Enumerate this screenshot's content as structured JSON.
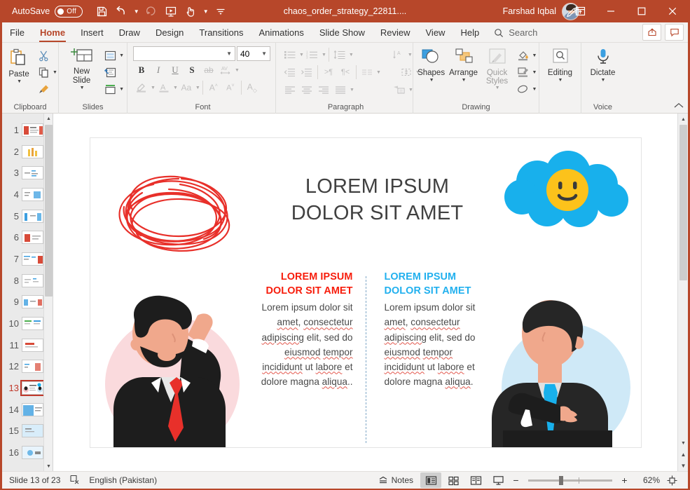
{
  "titlebar": {
    "autosave_label": "AutoSave",
    "autosave_state": "Off",
    "document_title": "chaos_order_strategy_22811....",
    "user_name": "Farshad Iqbal",
    "quick_access": [
      {
        "name": "save-icon",
        "label": "Save"
      },
      {
        "name": "undo-icon",
        "label": "Undo"
      },
      {
        "name": "redo-icon",
        "label": "Redo"
      },
      {
        "name": "start-presentation-icon",
        "label": "Start From Beginning"
      },
      {
        "name": "touch-mode-icon",
        "label": "Touch/Mouse Mode"
      },
      {
        "name": "customize-qat-icon",
        "label": "Customize Quick Access Toolbar"
      }
    ],
    "window_controls": [
      {
        "name": "minimize-button",
        "label": "Minimize"
      },
      {
        "name": "maximize-button",
        "label": "Maximize"
      },
      {
        "name": "close-button",
        "label": "Close"
      }
    ],
    "ribbon_display_icon": "ribbon-display-options-icon",
    "pen_icon": "pen-icon",
    "accent_color": "#b7472a"
  },
  "tabs": [
    {
      "label": "File",
      "active": false
    },
    {
      "label": "Home",
      "active": true
    },
    {
      "label": "Insert",
      "active": false
    },
    {
      "label": "Draw",
      "active": false
    },
    {
      "label": "Design",
      "active": false
    },
    {
      "label": "Transitions",
      "active": false
    },
    {
      "label": "Animations",
      "active": false
    },
    {
      "label": "Slide Show",
      "active": false
    },
    {
      "label": "Review",
      "active": false
    },
    {
      "label": "View",
      "active": false
    },
    {
      "label": "Help",
      "active": false
    }
  ],
  "search": {
    "label": "Search",
    "icon": "search-icon"
  },
  "tab_right_buttons": [
    {
      "name": "share-button",
      "icon": "share-icon"
    },
    {
      "name": "comments-button",
      "icon": "comment-icon"
    }
  ],
  "ribbon": {
    "groups": [
      {
        "name": "clipboard",
        "label": "Clipboard",
        "big_button": "Paste",
        "small_buttons": [
          "cut-icon",
          "copy-icon",
          "format-painter-icon"
        ],
        "has_launcher": true
      },
      {
        "name": "slides",
        "label": "Slides",
        "big_button": "New Slide",
        "small_buttons": [
          "layout-icon",
          "reset-icon",
          "section-icon"
        ],
        "has_launcher": false
      },
      {
        "name": "font",
        "label": "Font",
        "font_name_value": "",
        "font_size_value": "40",
        "row1": [
          "bold-icon",
          "italic-icon",
          "underline-icon",
          "text-shadow-icon",
          "strikethrough-icon",
          "character-spacing-icon"
        ],
        "row2": [
          "text-highlight-icon",
          "font-color-icon",
          "change-case-icon",
          "increase-font-size-icon",
          "decrease-font-size-icon",
          "clear-formatting-icon"
        ],
        "has_launcher": true
      },
      {
        "name": "paragraph",
        "label": "Paragraph",
        "row1": [
          "bullets-icon",
          "numbering-icon",
          "line-spacing-icon",
          "text-direction-icon"
        ],
        "row2": [
          "decrease-indent-icon",
          "increase-indent-icon",
          "ltr-icon",
          "rtl-icon",
          "columns-icon",
          "align-text-icon"
        ],
        "row3": [
          "align-left-icon",
          "align-center-icon",
          "align-right-icon",
          "justify-icon",
          "convert-smartart-icon"
        ],
        "has_launcher": true
      },
      {
        "name": "drawing",
        "label": "Drawing",
        "big_buttons": [
          "Shapes",
          "Arrange",
          "Quick Styles"
        ],
        "small_buttons": [
          "shape-fill-icon",
          "shape-outline-icon",
          "shape-effects-icon"
        ],
        "has_launcher": true
      },
      {
        "name": "editing",
        "label": "",
        "big_button": "Editing"
      },
      {
        "name": "voice",
        "label": "Voice",
        "big_button": "Dictate"
      }
    ],
    "collapse_icon": "collapse-ribbon-icon"
  },
  "thumbnails": {
    "selected": 13,
    "slides": [
      1,
      2,
      3,
      4,
      5,
      6,
      7,
      8,
      9,
      10,
      11,
      12,
      13,
      14,
      15,
      16
    ]
  },
  "slide": {
    "title_line1": "LOREM IPSUM",
    "title_line2": "DOLOR SIT AMET",
    "left_block": {
      "heading_line1": "LOREM IPSUM",
      "heading_line2": "DOLOR SIT AMET",
      "body_segments": [
        {
          "text": "Lorem ipsum dolor sit ",
          "squiggly": false
        },
        {
          "text": "amet",
          "squiggly": true
        },
        {
          "text": ", ",
          "squiggly": false
        },
        {
          "text": "consectetur",
          "squiggly": true
        },
        {
          "text": " ",
          "squiggly": false
        },
        {
          "text": "adipiscing",
          "squiggly": true
        },
        {
          "text": " elit, sed do ",
          "squiggly": false
        },
        {
          "text": "eiusmod",
          "squiggly": true
        },
        {
          "text": " ",
          "squiggly": false
        },
        {
          "text": "tempor",
          "squiggly": true
        },
        {
          "text": " ",
          "squiggly": false
        },
        {
          "text": "incididunt",
          "squiggly": true
        },
        {
          "text": " ut ",
          "squiggly": false
        },
        {
          "text": "labore",
          "squiggly": true
        },
        {
          "text": " et dolore magna ",
          "squiggly": false
        },
        {
          "text": "aliqua",
          "squiggly": true
        },
        {
          "text": "..",
          "squiggly": false
        }
      ],
      "heading_color": "#f71d0c"
    },
    "right_block": {
      "heading_line1": "LOREM IPSUM",
      "heading_line2": "DOLOR SIT AMET",
      "body_segments": [
        {
          "text": "Lorem ipsum dolor sit ",
          "squiggly": false
        },
        {
          "text": "amet",
          "squiggly": true
        },
        {
          "text": ", ",
          "squiggly": false
        },
        {
          "text": "consectetur",
          "squiggly": true
        },
        {
          "text": " ",
          "squiggly": false
        },
        {
          "text": "adipiscing",
          "squiggly": true
        },
        {
          "text": " elit, sed do ",
          "squiggly": false
        },
        {
          "text": "eiusmod",
          "squiggly": true
        },
        {
          "text": " ",
          "squiggly": false
        },
        {
          "text": "tempor",
          "squiggly": true
        },
        {
          "text": " ",
          "squiggly": false
        },
        {
          "text": "incididunt",
          "squiggly": true
        },
        {
          "text": " ut ",
          "squiggly": false
        },
        {
          "text": "labore",
          "squiggly": true
        },
        {
          "text": " et dolore magna ",
          "squiggly": false
        },
        {
          "text": "aliqua",
          "squiggly": true
        },
        {
          "text": ".",
          "squiggly": false
        }
      ],
      "heading_color": "#21b0ee"
    },
    "graphics": {
      "scribble": "red-scribble-graphic",
      "cloud": "blue-cloud-smiley-graphic",
      "left_person": "confused-man-illustration",
      "right_person": "confident-man-illustration",
      "scribble_color": "#e8302a",
      "cloud_color": "#18b0ec",
      "smiley_color": "#fcc21b",
      "left_circle_color": "#fadadd",
      "right_circle_color": "#cfe9f7"
    }
  },
  "statusbar": {
    "slide_counter": "Slide 13 of 23",
    "accessibility_icon": "accessibility-checker-icon",
    "language": "English (Pakistan)",
    "notes_label": "Notes",
    "notes_icon": "notes-icon",
    "views": [
      {
        "name": "normal-view-button",
        "icon": "normal-view-icon",
        "active": true
      },
      {
        "name": "slide-sorter-button",
        "icon": "slide-sorter-icon",
        "active": false
      },
      {
        "name": "reading-view-button",
        "icon": "reading-view-icon",
        "active": false
      },
      {
        "name": "slide-show-button",
        "icon": "slide-show-icon",
        "active": false
      }
    ],
    "zoom_out_label": "−",
    "zoom_in_label": "+",
    "zoom_value": "62%",
    "fit_icon": "fit-slide-to-window-icon"
  }
}
